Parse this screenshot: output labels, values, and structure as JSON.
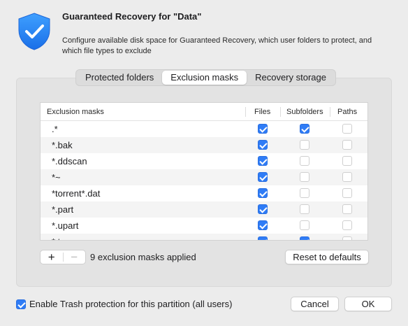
{
  "dialog": {
    "title": "Guaranteed Recovery for \"Data\"",
    "description": "Configure available disk space for Guaranteed Recovery, which user folders to protect, and which file types to exclude",
    "icon": "shield-check-icon",
    "accent_color": "#2f7cf6"
  },
  "tabs": [
    {
      "label": "Protected folders",
      "active": false
    },
    {
      "label": "Exclusion masks",
      "active": true
    },
    {
      "label": "Recovery storage",
      "active": false
    }
  ],
  "table": {
    "headers": {
      "mask": "Exclusion masks",
      "files": "Files",
      "subfolders": "Subfolders",
      "paths": "Paths"
    },
    "rows": [
      {
        "mask": ".*",
        "files": true,
        "subfolders": true,
        "paths": false
      },
      {
        "mask": "*.bak",
        "files": true,
        "subfolders": false,
        "paths": false
      },
      {
        "mask": "*.ddscan",
        "files": true,
        "subfolders": false,
        "paths": false
      },
      {
        "mask": "*~",
        "files": true,
        "subfolders": false,
        "paths": false
      },
      {
        "mask": "*torrent*.dat",
        "files": true,
        "subfolders": false,
        "paths": false
      },
      {
        "mask": "*.part",
        "files": true,
        "subfolders": false,
        "paths": false
      },
      {
        "mask": "*.upart",
        "files": true,
        "subfolders": false,
        "paths": false
      },
      {
        "mask": "*.tmp",
        "files": true,
        "subfolders": true,
        "paths": false
      }
    ]
  },
  "controls": {
    "add_label": "+",
    "remove_label": "−",
    "count_text": "9 exclusion masks applied",
    "reset_label": "Reset to defaults"
  },
  "footer": {
    "trash_label": "Enable Trash protection for this partition (all users)",
    "trash_checked": true,
    "cancel_label": "Cancel",
    "ok_label": "OK"
  }
}
